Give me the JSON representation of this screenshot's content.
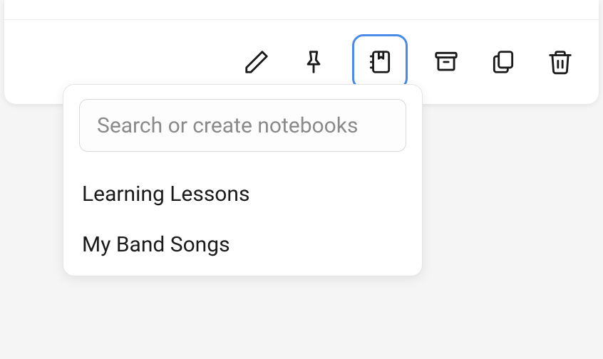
{
  "search": {
    "placeholder": "Search or create notebooks",
    "value": ""
  },
  "notebooks": {
    "items": [
      {
        "label": "Learning Lessons"
      },
      {
        "label": "My Band Songs"
      }
    ]
  }
}
